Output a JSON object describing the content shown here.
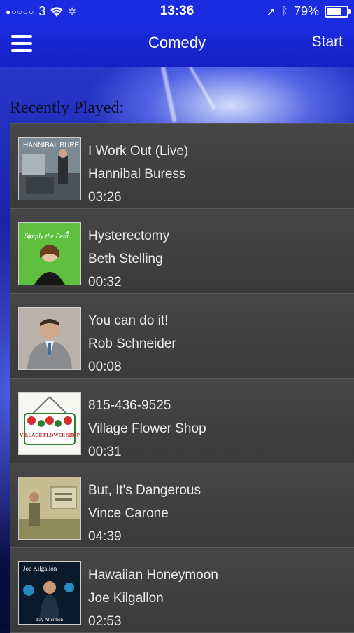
{
  "status_bar": {
    "carrier": "3",
    "time": "13:36",
    "battery_text": "79%",
    "battery_level": 0.79
  },
  "nav": {
    "title": "Comedy",
    "start_label": "Start"
  },
  "section": {
    "title": "Recently Played:"
  },
  "tracks": [
    {
      "title": "I Work Out (Live)",
      "artist": "Hannibal Buress",
      "duration": "03:26",
      "art_icon": "hannibal-buress-album-art",
      "art_text": "HANNIBAL BURESS"
    },
    {
      "title": "Hysterectomy",
      "artist": "Beth Stelling",
      "duration": "00:32",
      "art_icon": "beth-stelling-album-art",
      "art_text": "Simply the Beth"
    },
    {
      "title": "You can do it!",
      "artist": "Rob Schneider",
      "duration": "00:08",
      "art_icon": "rob-schneider-album-art"
    },
    {
      "title": "815-436-9525",
      "artist": "Village Flower Shop",
      "duration": "00:31",
      "art_icon": "village-flower-shop-logo",
      "art_text": "VILLAGE FLOWER SHOP"
    },
    {
      "title": "But, It's Dangerous",
      "artist": "Vince Carone",
      "duration": "04:39",
      "art_icon": "vince-carone-album-art"
    },
    {
      "title": "Hawaiian Honeymoon",
      "artist": "Joe Kilgallon",
      "duration": "02:53",
      "art_icon": "joe-kilgallon-album-art",
      "art_text": "Joe Kilgallon",
      "art_subtext": "Pay Attention"
    }
  ]
}
